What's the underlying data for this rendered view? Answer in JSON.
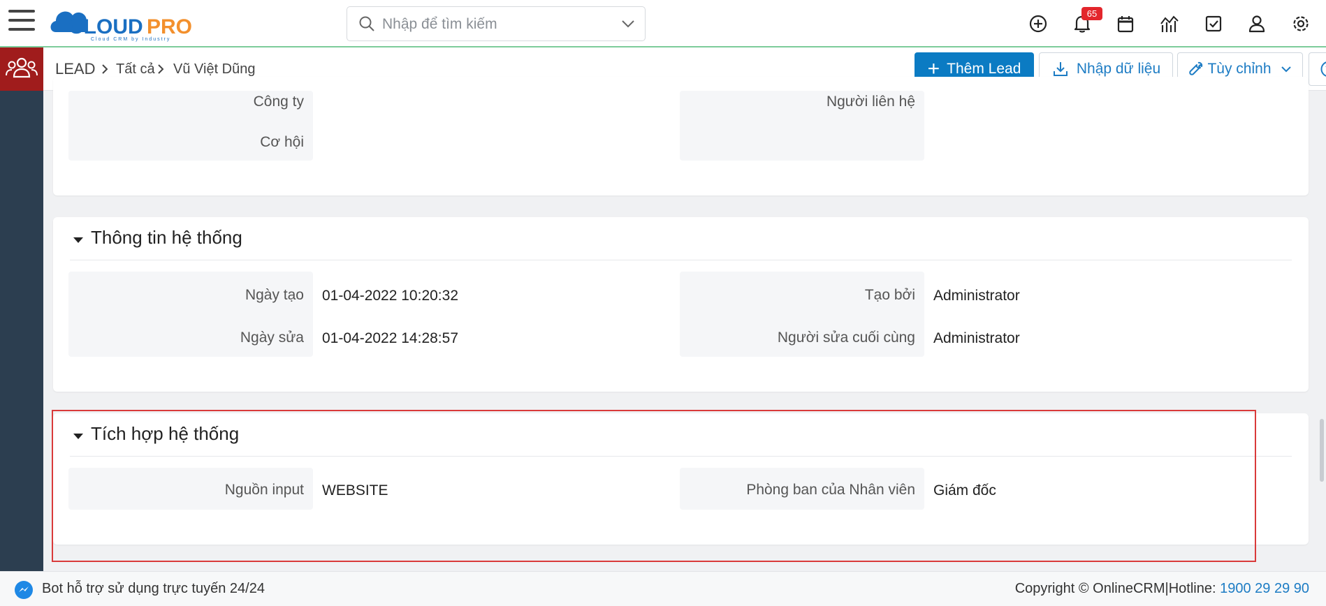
{
  "app": {
    "logo_text": "CLOUDPRO",
    "logo_tagline": "Cloud CRM by Industry"
  },
  "search": {
    "placeholder": "Nhập để tìm kiếm"
  },
  "topbar": {
    "notification_count": "65"
  },
  "breadcrumb": {
    "module": "LEAD",
    "list": "Tất cả",
    "record": "Vũ Việt Dũng"
  },
  "actions": {
    "add_label": "Thêm Lead",
    "import_label": "Nhập dữ liệu",
    "customize_label": "Tùy chỉnh"
  },
  "section_top": {
    "rows": [
      {
        "left_label": "Công ty",
        "left_value": "",
        "right_label": "Người liên hệ",
        "right_value": ""
      },
      {
        "left_label": "Cơ hội",
        "left_value": ""
      }
    ]
  },
  "section_system": {
    "title": "Thông tin hệ thống",
    "created_label": "Ngày tạo",
    "created_value": "01-04-2022 10:20:32",
    "created_by_label": "Tạo bởi",
    "created_by_value": "Administrator",
    "modified_label": "Ngày sửa",
    "modified_value": "01-04-2022 14:28:57",
    "modified_by_label": "Người sửa cuối cùng",
    "modified_by_value": "Administrator"
  },
  "section_integration": {
    "title": "Tích hợp hệ thống",
    "source_label": "Nguồn input",
    "source_value": "WEBSITE",
    "department_label": "Phòng ban của Nhân viên",
    "department_value": "Giám đốc"
  },
  "footer": {
    "bot_text": "Bot hỗ trợ sử dụng trực tuyến 24/24",
    "copyright": "Copyright © OnlineCRM",
    "hotline_label": "|Hotline: ",
    "hotline_number": "1900 29 29 90"
  },
  "colors": {
    "primary": "#0b7bc3",
    "nav_dark": "#2c3e50",
    "lead_red": "#a01c1c",
    "highlight": "#d93a3a",
    "logo_blue": "#1a6fc2",
    "logo_orange": "#f3902d"
  },
  "icons": [
    "menu-icon",
    "search-icon",
    "chevron-down-icon",
    "plus-circle-icon",
    "bell-icon",
    "calendar-icon",
    "chart-icon",
    "checkbox-icon",
    "user-icon",
    "gear-icon",
    "users-icon",
    "messenger-icon",
    "download-icon",
    "wrench-icon",
    "help-icon"
  ]
}
